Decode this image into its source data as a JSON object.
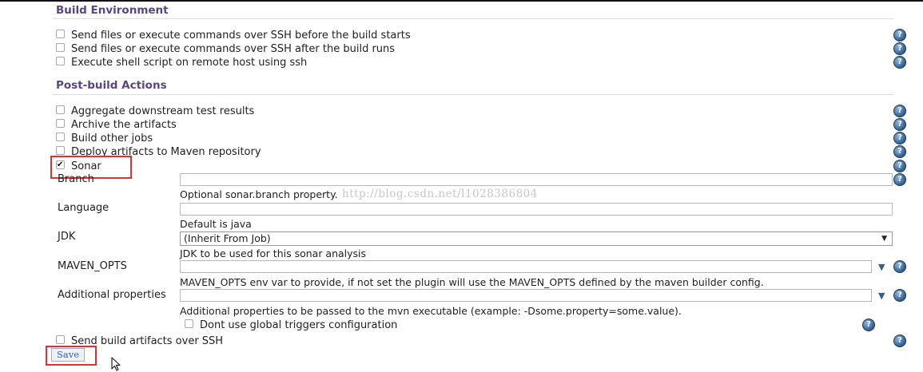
{
  "build_environment": {
    "title": "Build Environment",
    "options": [
      {
        "label": "Send files or execute commands over SSH before the build starts",
        "checked": false
      },
      {
        "label": "Send files or execute commands over SSH after the build runs",
        "checked": false
      },
      {
        "label": "Execute shell script on remote host using ssh",
        "checked": false
      }
    ]
  },
  "post_build": {
    "title": "Post-build Actions",
    "options": [
      {
        "label": "Aggregate downstream test results",
        "checked": false
      },
      {
        "label": "Archive the artifacts",
        "checked": false
      },
      {
        "label": "Build other jobs",
        "checked": false
      },
      {
        "label": "Deploy artifacts to Maven repository",
        "checked": false
      },
      {
        "label": "Sonar",
        "checked": true
      }
    ]
  },
  "sonar": {
    "branch": {
      "label": "Branch",
      "value": "",
      "description": "Optional sonar.branch property."
    },
    "language": {
      "label": "Language",
      "value": "",
      "description": "Default is java"
    },
    "jdk": {
      "label": "JDK",
      "selected": "(Inherit From Job)",
      "description": "JDK to be used for this sonar analysis"
    },
    "maven_opts": {
      "label": "MAVEN_OPTS",
      "value": "",
      "description": "MAVEN_OPTS env var to provide, if not set the plugin will use the MAVEN_OPTS defined by the maven builder config."
    },
    "additional_properties": {
      "label": "Additional properties",
      "value": "",
      "description": "Additional properties to be passed to the mvn executable (example: -Dsome.property=some.value)."
    },
    "global_triggers": {
      "label": "Dont use global triggers configuration",
      "checked": false
    }
  },
  "send_build_artifacts": {
    "label": "Send build artifacts over SSH",
    "checked": false
  },
  "save_label": "Save",
  "watermark": "http://blog.csdn.net/l1028386804",
  "icons": {
    "help": "help-icon",
    "expand": "expand-arrow-icon",
    "select": "dropdown-arrow-icon",
    "cursor": "mouse-cursor-icon"
  },
  "colors": {
    "section_title": "#5a4682",
    "highlight_box": "#e23030",
    "help_icon": "#2f5f91"
  }
}
